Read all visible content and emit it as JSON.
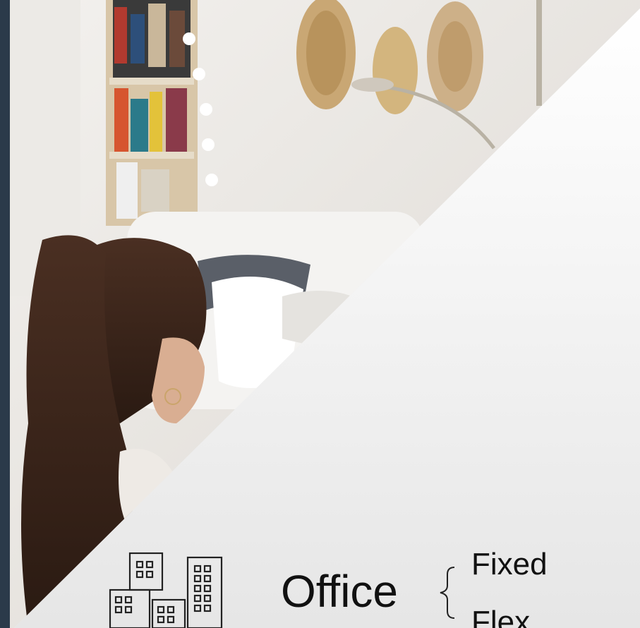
{
  "office": {
    "label": "Office",
    "options": [
      "Fixed",
      "Flex"
    ]
  },
  "icons": {
    "office": "office-buildings-icon"
  },
  "colors": {
    "gradient_top": "#ffffff",
    "gradient_bottom": "#e6e6e6",
    "text": "#111111"
  }
}
